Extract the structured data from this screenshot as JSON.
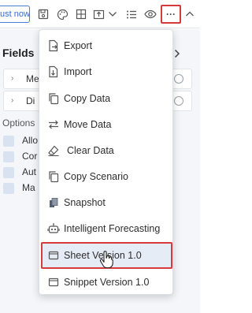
{
  "toolbar": {
    "adjust_label": "ust now",
    "icons": [
      "save-icon",
      "palette-icon",
      "grid-icon",
      "export-icon",
      "chevron-down-icon",
      "list-icon",
      "eye-icon",
      "more-icon",
      "chevron-up-icon"
    ],
    "more_label": "···"
  },
  "panel": {
    "title": "Fields",
    "rows": [
      {
        "label": "Me"
      },
      {
        "label": "Di"
      }
    ],
    "options_title": "Options",
    "options": [
      {
        "label": "Allo"
      },
      {
        "label": "Cor"
      },
      {
        "label": "Aut"
      },
      {
        "label": "Ma"
      }
    ]
  },
  "menu": {
    "items": [
      {
        "label": "Export",
        "icon": "export-file-icon"
      },
      {
        "label": "Import",
        "icon": "import-file-icon"
      },
      {
        "label": "Copy Data",
        "icon": "copy-icon"
      },
      {
        "label": "Move Data",
        "icon": "move-arrows-icon"
      },
      {
        "label": "Clear Data",
        "icon": "eraser-icon"
      },
      {
        "label": "Copy Scenario",
        "icon": "copy-scenario-icon"
      },
      {
        "label": "Snapshot",
        "icon": "snapshot-icon"
      },
      {
        "label": "Intelligent Forecasting",
        "icon": "robot-icon"
      },
      {
        "label": "Sheet Version 1.0",
        "icon": "sheet-version-icon"
      },
      {
        "label": "Snippet Version 1.0",
        "icon": "snippet-version-icon"
      }
    ],
    "hovered_item": "Sheet Version 1.0"
  },
  "colors": {
    "accent": "#2f6fcf",
    "highlight_border": "#d63b3b",
    "hover_bg": "#e6ecf5"
  }
}
